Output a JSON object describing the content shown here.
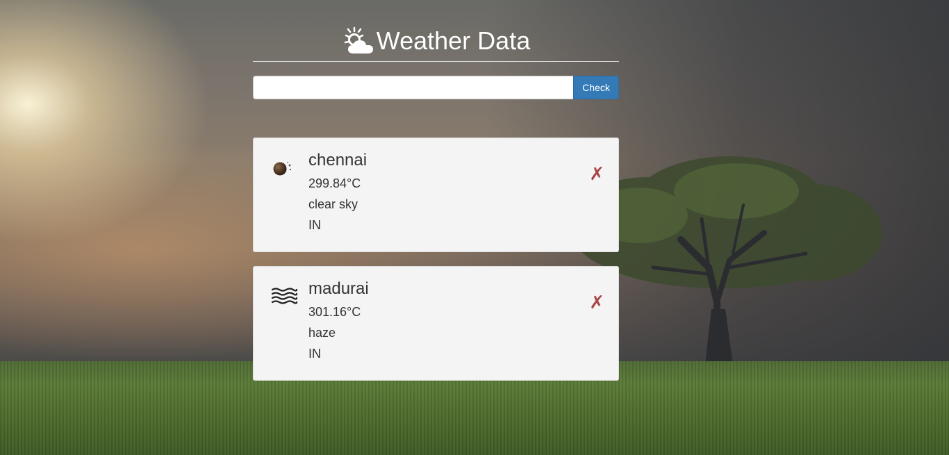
{
  "header": {
    "title": "Weather Data",
    "icon": "sun-behind-cloud-icon"
  },
  "search": {
    "value": "",
    "placeholder": "",
    "button_label": "Check"
  },
  "colors": {
    "button": "#337ab7",
    "remove": "#a94442",
    "card": "#f4f4f4"
  },
  "cards": [
    {
      "city": "chennai",
      "temperature": "299.84°C",
      "description": "clear sky",
      "country": "IN",
      "icon": "moon-icon",
      "remove_label": "✗"
    },
    {
      "city": "madurai",
      "temperature": "301.16°C",
      "description": "haze",
      "country": "IN",
      "icon": "haze-icon",
      "remove_label": "✗"
    }
  ]
}
